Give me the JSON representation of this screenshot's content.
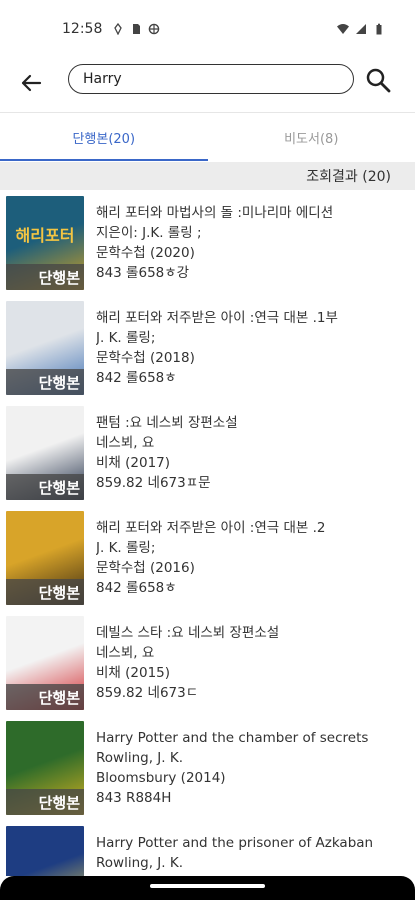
{
  "status": {
    "time": "12:58"
  },
  "search": {
    "value": "Harry"
  },
  "tabs": [
    {
      "label": "단행본(20)",
      "active": true
    },
    {
      "label": "비도서(8)",
      "active": false
    }
  ],
  "result_summary": "조회결과 (20)",
  "colors": {
    "accent": "#3a67c8",
    "result_bar": "#ececec"
  },
  "books": [
    {
      "title": "해리 포터와 마법사의 돌 :미나리마 에디션",
      "author": "지은이: J.K. 롤링 ;",
      "publisher": "문학수첩 (2020)",
      "call_number": "843 롤658ㅎ강",
      "badge": "단행본",
      "cover_title": "해리포터",
      "cover_colors": [
        "#1d5e7b",
        "#d4a21f"
      ]
    },
    {
      "title": "해리 포터와 저주받은 아이 :연극 대본 .1부",
      "author": "J. K. 롤링;",
      "publisher": "문학수첩 (2018)",
      "call_number": "842 롤658ㅎ",
      "badge": "단행본",
      "cover_title": "",
      "cover_colors": [
        "#dfe3e8",
        "#3c6fb4"
      ]
    },
    {
      "title": "팬텀 :요 네스뵈 장편소설",
      "author": "네스뵈, 요",
      "publisher": "비채 (2017)",
      "call_number": "859.82 네673ㅍ문",
      "badge": "단행본",
      "cover_title": "",
      "cover_colors": [
        "#f1f1f1",
        "#1c2a44"
      ]
    },
    {
      "title": "해리 포터와 저주받은 아이 :연극 대본 .2",
      "author": "J. K. 롤링;",
      "publisher": "문학수첩 (2016)",
      "call_number": "842 롤658ㅎ",
      "badge": "단행본",
      "cover_title": "",
      "cover_colors": [
        "#d8a429",
        "#3b2a12"
      ]
    },
    {
      "title": "데빌스 스타 :요 네스뵈 장편소설",
      "author": "네스뵈, 요",
      "publisher": "비채 (2015)",
      "call_number": "859.82 네673ㄷ",
      "badge": "단행본",
      "cover_title": "",
      "cover_colors": [
        "#f3f3f3",
        "#d1262b"
      ]
    },
    {
      "title": "Harry Potter and the chamber of secrets",
      "author": "Rowling, J. K.",
      "publisher": "Bloomsbury (2014)",
      "call_number": "843 R884H",
      "badge": "단행본",
      "cover_title": "",
      "cover_colors": [
        "#2e6b2a",
        "#d8b321"
      ]
    },
    {
      "title": "Harry Potter and the prisoner of Azkaban",
      "author": "Rowling, J. K.",
      "publisher": "",
      "call_number": "",
      "badge": "",
      "cover_title": "",
      "cover_colors": [
        "#1e3d82",
        "#f1d94b"
      ]
    }
  ]
}
